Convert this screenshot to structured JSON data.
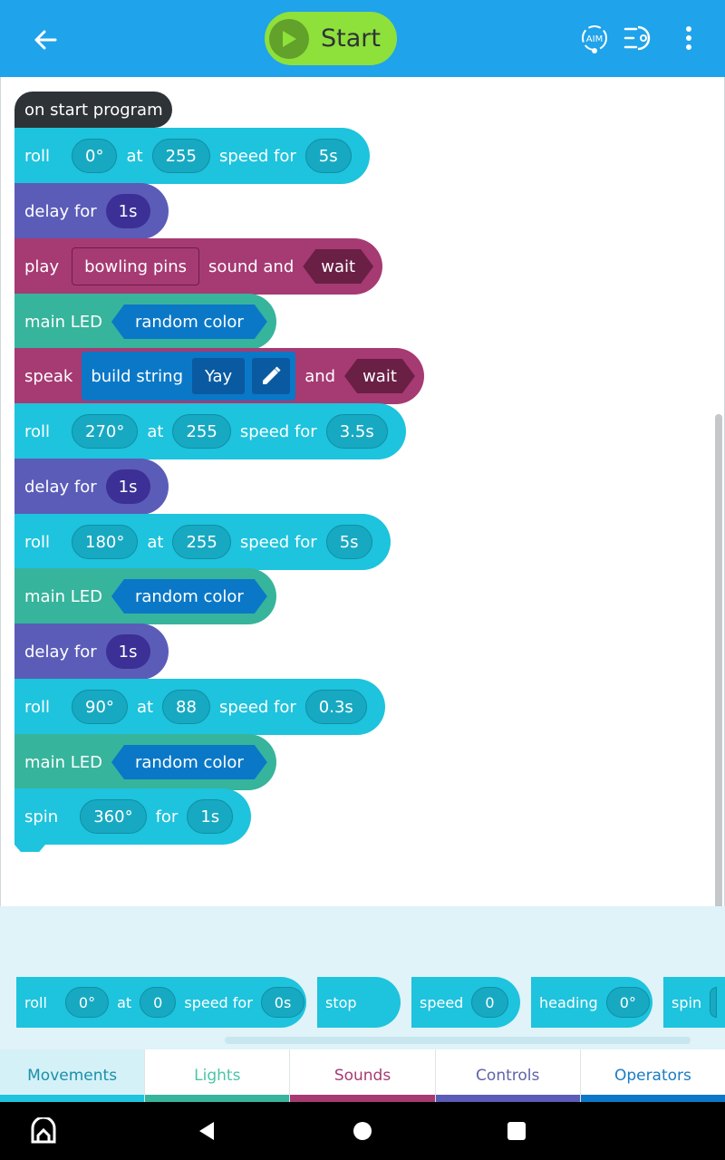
{
  "header": {
    "start_label": "Start",
    "aim_label": "AIM",
    "colors": {
      "bar": "#1fa3ea",
      "start": "#8ee03b"
    }
  },
  "program": {
    "hat": "on start program",
    "blocks": [
      {
        "kind": "roll",
        "label": "roll",
        "heading": "0°",
        "at": "at",
        "speed": "255",
        "speed_for": "speed for",
        "duration": "5s"
      },
      {
        "kind": "delay",
        "label": "delay for",
        "value": "1s"
      },
      {
        "kind": "sound",
        "label": "play",
        "sound": "bowling pins",
        "mid": "sound and",
        "mode": "wait"
      },
      {
        "kind": "led",
        "label": "main LED",
        "value": "random color"
      },
      {
        "kind": "speak",
        "label": "speak",
        "build": "build string",
        "text": "Yay",
        "and": "and",
        "mode": "wait"
      },
      {
        "kind": "roll",
        "label": "roll",
        "heading": "270°",
        "at": "at",
        "speed": "255",
        "speed_for": "speed for",
        "duration": "3.5s"
      },
      {
        "kind": "delay",
        "label": "delay for",
        "value": "1s"
      },
      {
        "kind": "roll",
        "label": "roll",
        "heading": "180°",
        "at": "at",
        "speed": "255",
        "speed_for": "speed for",
        "duration": "5s"
      },
      {
        "kind": "led",
        "label": "main LED",
        "value": "random color"
      },
      {
        "kind": "delay",
        "label": "delay for",
        "value": "1s"
      },
      {
        "kind": "roll",
        "label": "roll",
        "heading": "90°",
        "at": "at",
        "speed": "88",
        "speed_for": "speed for",
        "duration": "0.3s"
      },
      {
        "kind": "led",
        "label": "main LED",
        "value": "random color"
      },
      {
        "kind": "spin",
        "label": "spin",
        "angle": "360°",
        "for": "for",
        "duration": "1s"
      }
    ]
  },
  "tray": {
    "roll": {
      "label": "roll",
      "heading": "0°",
      "at": "at",
      "speed": "0",
      "speed_for": "speed for",
      "duration": "0s"
    },
    "stop": {
      "label": "stop"
    },
    "speed": {
      "label": "speed",
      "value": "0"
    },
    "heading": {
      "label": "heading",
      "value": "0°"
    },
    "spin": {
      "label": "spin"
    }
  },
  "tabs": [
    {
      "label": "Movements",
      "color": "#1ec3dd",
      "text_color": "#1b8fa8"
    },
    {
      "label": "Lights",
      "color": "#37b49c",
      "text_color": "#4cc4a8"
    },
    {
      "label": "Sounds",
      "color": "#a63a73",
      "text_color": "#a63a73"
    },
    {
      "label": "Controls",
      "color": "#5b5cb8",
      "text_color": "#5f63a8"
    },
    {
      "label": "Operators",
      "color": "#0a78c7",
      "text_color": "#1a7bc4"
    }
  ]
}
